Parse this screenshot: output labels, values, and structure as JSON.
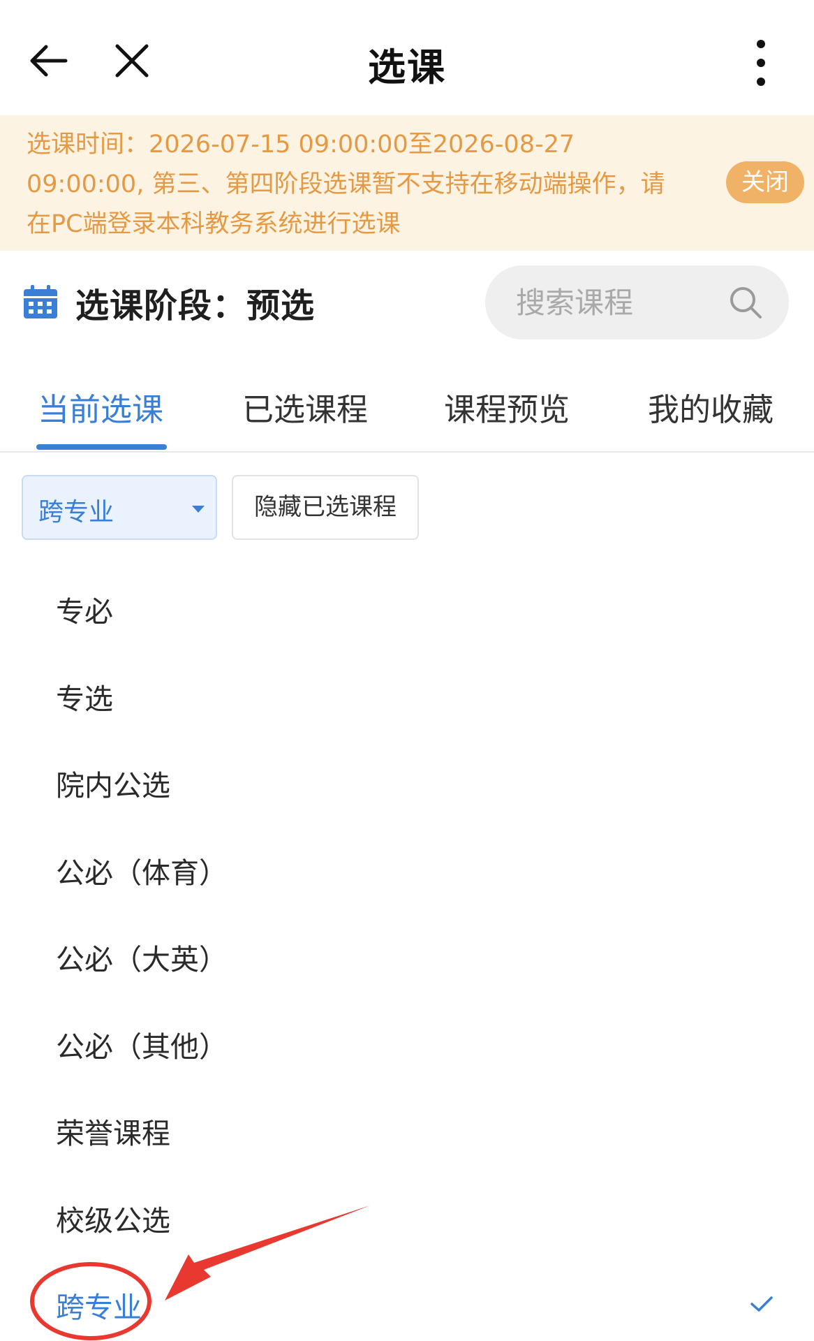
{
  "header": {
    "title": "选课"
  },
  "notice": {
    "line1": "选课时间：2026-07-15 09:00:00至2026-08-27",
    "line2": "09:00:00, 第三、第四阶段选课暂不支持在移动端操作，请",
    "line3": "在PC端登录本科教务系统进行选课",
    "close_label": "关闭"
  },
  "stage": {
    "label": "选课阶段：预选"
  },
  "search": {
    "placeholder": "搜索课程"
  },
  "tabs": [
    {
      "label": "当前选课",
      "active": true
    },
    {
      "label": "已选课程",
      "active": false
    },
    {
      "label": "课程预览",
      "active": false
    },
    {
      "label": "我的收藏",
      "active": false
    }
  ],
  "filter": {
    "selected": "跨专业",
    "hide_selected_label": "隐藏已选课程"
  },
  "options": [
    {
      "label": "专必"
    },
    {
      "label": "专选"
    },
    {
      "label": "院内公选"
    },
    {
      "label": "公必（体育）"
    },
    {
      "label": "公必（大英）"
    },
    {
      "label": "公必（其他）"
    },
    {
      "label": "荣誉课程"
    },
    {
      "label": "校级公选"
    },
    {
      "label": "跨专业",
      "selected": true
    }
  ],
  "colors": {
    "accent": "#3a7fd6",
    "notice_bg": "#fdf3e3",
    "notice_text": "#e49a45",
    "notice_button": "#f0b267",
    "annotation": "#e8382f"
  }
}
